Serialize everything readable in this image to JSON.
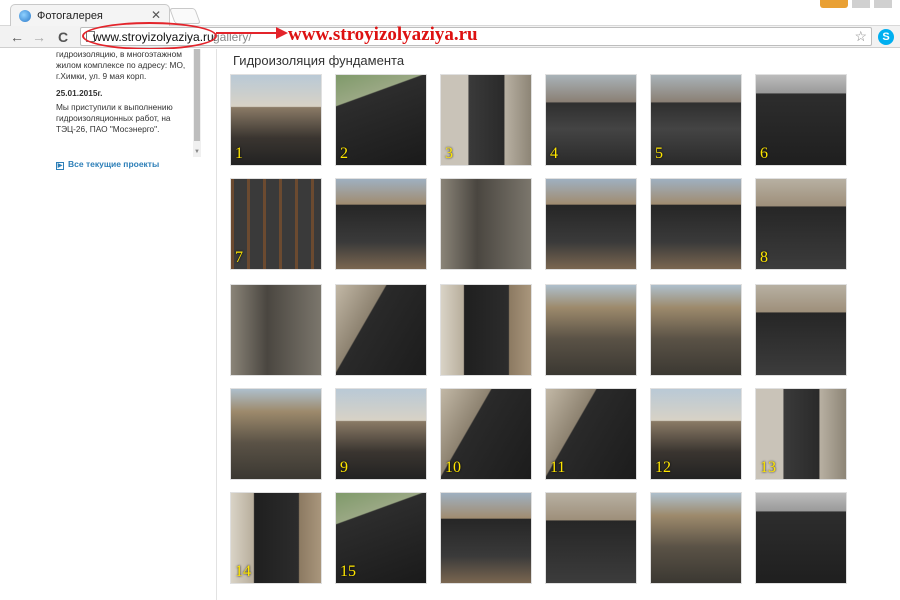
{
  "browser": {
    "tab_title": "Фотогалерея",
    "tab_close": "✕",
    "back_icon": "←",
    "forward_icon": "→",
    "reload_icon": "C",
    "url_host": "www.stroyizolyaziya.ru/",
    "url_path": "gallery/",
    "star_icon": "☆",
    "skype_icon": "S"
  },
  "annotation": {
    "text": "www.stroyizolyaziya.ru"
  },
  "sidebar": {
    "news": [
      "гидроизоляцию, в многоэтажном жилом комплексе по адресу: МО, г.Химки, ул. 9 мая корп."
    ],
    "date": "25.01.2015г.",
    "news2": "Мы приступили к выполнению гидроизоляционных работ, на ТЭЦ-26, ПАО \"Мосэнерго\".",
    "all_projects": "Все текущие проекты"
  },
  "gallery": {
    "heading": "Гидроизоляция фундамента",
    "thumbs": [
      {
        "num": "1",
        "scene": "house"
      },
      {
        "num": "2",
        "scene": "membrane"
      },
      {
        "num": "3",
        "scene": "pillar"
      },
      {
        "num": "4",
        "scene": "walls"
      },
      {
        "num": "5",
        "scene": "walls"
      },
      {
        "num": "6",
        "scene": "box"
      },
      {
        "num": "7",
        "scene": "rebar"
      },
      {
        "num": "",
        "scene": "pit"
      },
      {
        "num": "",
        "scene": "concrete"
      },
      {
        "num": "",
        "scene": "pit"
      },
      {
        "num": "",
        "scene": "pit"
      },
      {
        "num": "8",
        "scene": "slab"
      },
      {
        "num": "",
        "scene": "concrete"
      },
      {
        "num": "",
        "scene": "spray"
      },
      {
        "num": "",
        "scene": "wall"
      },
      {
        "num": "",
        "scene": "site"
      },
      {
        "num": "",
        "scene": "site"
      },
      {
        "num": "",
        "scene": "slab"
      },
      {
        "num": "",
        "scene": "site"
      },
      {
        "num": "9",
        "scene": "house"
      },
      {
        "num": "10",
        "scene": "spray"
      },
      {
        "num": "11",
        "scene": "spray"
      },
      {
        "num": "12",
        "scene": "house"
      },
      {
        "num": "13",
        "scene": "pillar"
      },
      {
        "num": "14",
        "scene": "wall"
      },
      {
        "num": "15",
        "scene": "membrane"
      },
      {
        "num": "",
        "scene": "pit"
      },
      {
        "num": "",
        "scene": "slab"
      },
      {
        "num": "",
        "scene": "site"
      },
      {
        "num": "",
        "scene": "box"
      }
    ]
  }
}
